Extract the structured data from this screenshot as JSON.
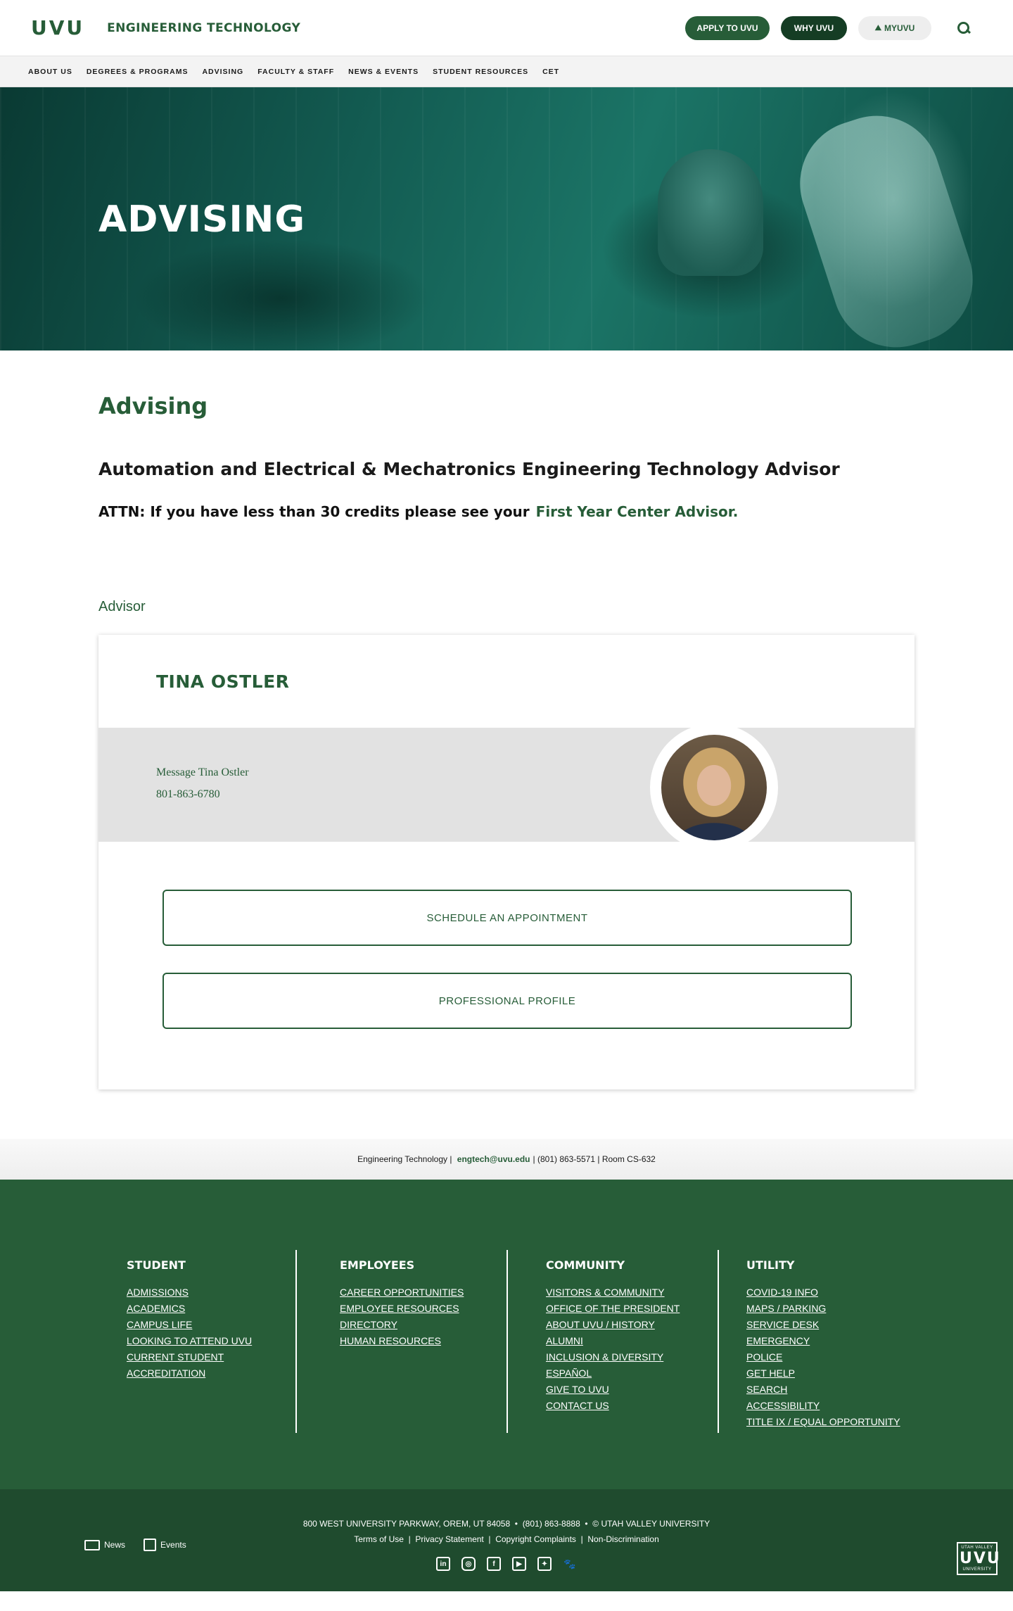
{
  "header": {
    "logo": "UVU",
    "department": "ENGINEERING TECHNOLOGY",
    "apply": "APPLY TO UVU",
    "why": "WHY UVU",
    "myuvu": "MYUVU"
  },
  "nav": [
    "ABOUT US",
    "DEGREES & PROGRAMS",
    "ADVISING",
    "FACULTY & STAFF",
    "NEWS & EVENTS",
    "STUDENT RESOURCES",
    "CET"
  ],
  "hero": {
    "title": "ADVISING"
  },
  "content": {
    "heading": "Advising",
    "advisor_title": "Automation and Electrical & Mechatronics Engineering Technology Advisor",
    "attn_text": "ATTN: If you have less than 30 credits please see your",
    "attn_link": "First Year Center Advisor.",
    "section_label": "Advisor"
  },
  "advisor": {
    "name": "TINA OSTLER",
    "message": "Message Tina Ostler",
    "phone": "801-863-6780",
    "schedule": "SCHEDULE AN APPOINTMENT",
    "profile": "PROFESSIONAL PROFILE"
  },
  "contact": {
    "dept": "Engineering Technology",
    "email": "engtech@uvu.edu",
    "phone": "(801) 863-5571",
    "room": "Room CS-632"
  },
  "footer": {
    "student": {
      "title": "STUDENT",
      "links": [
        "ADMISSIONS",
        "ACADEMICS",
        "CAMPUS LIFE",
        "LOOKING TO ATTEND UVU",
        "CURRENT STUDENT",
        "ACCREDITATION"
      ]
    },
    "employees": {
      "title": "EMPLOYEES",
      "links": [
        "CAREER OPPORTUNITIES",
        "EMPLOYEE RESOURCES",
        "DIRECTORY",
        "HUMAN RESOURCES"
      ]
    },
    "community": {
      "title": "COMMUNITY",
      "links": [
        "VISITORS & COMMUNITY",
        "OFFICE OF THE PRESIDENT",
        "ABOUT UVU / HISTORY",
        "ALUMNI",
        "INCLUSION & DIVERSITY",
        "ESPAÑOL",
        "GIVE TO UVU",
        "CONTACT US"
      ]
    },
    "utility": {
      "title": "UTILITY",
      "links": [
        "COVID-19 INFO",
        "MAPS / PARKING",
        "SERVICE DESK",
        "EMERGENCY",
        "POLICE",
        "GET HELP",
        "SEARCH",
        "ACCESSIBILITY",
        "TITLE IX / EQUAL OPPORTUNITY"
      ]
    }
  },
  "bottom": {
    "address": "800 WEST UNIVERSITY PARKWAY, OREM, UT 84058",
    "phone": "(801) 863-8888",
    "copyright": "© UTAH VALLEY UNIVERSITY",
    "links": [
      "Terms of Use",
      "Privacy Statement",
      "Copyright Complaints",
      "Non-Discrimination"
    ],
    "news": "News",
    "events": "Events",
    "logo_small": "UTAH VALLEY",
    "logo_big": "UVU",
    "logo_bottom": "UNIVERSITY"
  },
  "colors": {
    "brand_green": "#275d38",
    "dark_green": "#1f4b2e"
  },
  "icons": [
    "search-icon",
    "linkedin-icon",
    "instagram-icon",
    "facebook-icon",
    "youtube-icon",
    "twitter-icon",
    "wolverine-icon",
    "news-icon",
    "calendar-icon"
  ]
}
